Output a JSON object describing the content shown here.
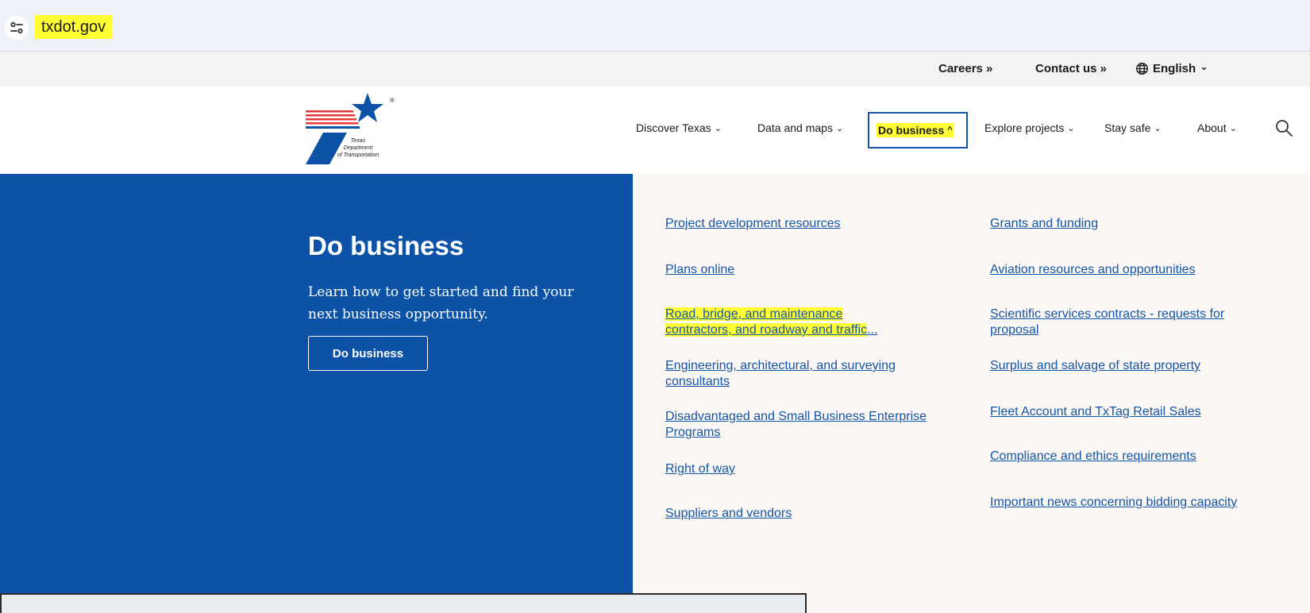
{
  "browser": {
    "url": "txdot.gov"
  },
  "utility_nav": {
    "careers": "Careers »",
    "contact": "Contact us »",
    "language": "English",
    "language_chevron": "⌄"
  },
  "logo": {
    "text_line1": "Texas",
    "text_line2": "Department",
    "text_line3": "of Transportation",
    "registered": "®"
  },
  "main_nav": {
    "chevron_down": "⌄",
    "chevron_up": "^",
    "items": [
      {
        "label": "Discover Texas"
      },
      {
        "label": "Data and maps"
      },
      {
        "label": "Do business"
      },
      {
        "label": "Explore projects"
      },
      {
        "label": "Stay safe"
      },
      {
        "label": "About"
      }
    ]
  },
  "panel": {
    "title": "Do business",
    "description": "Learn how to get started and find your next business opportunity.",
    "button": "Do business"
  },
  "links": {
    "col1": [
      {
        "text": "Project development resources"
      },
      {
        "text": "Plans online"
      },
      {
        "line1": "Road, bridge, and maintenance",
        "line2": "contractors, and roadway and traffic",
        "ellipsis": "..."
      },
      {
        "text": "Engineering, architectural, and surveying consultants"
      },
      {
        "text": "Disadvantaged and Small Business Enterprise Programs"
      },
      {
        "text": "Right of way"
      },
      {
        "text": "Suppliers and vendors"
      }
    ],
    "col2": [
      {
        "text": "Grants and funding"
      },
      {
        "text": "Aviation resources and opportunities"
      },
      {
        "text": "Scientific services contracts - requests for proposal"
      },
      {
        "text": "Surplus and salvage of state property"
      },
      {
        "text": "Fleet Account and TxTag Retail Sales"
      },
      {
        "text": "Compliance and ethics requirements"
      },
      {
        "text": "Important news concerning bidding capacity"
      }
    ]
  },
  "colors": {
    "brand_blue": "#0c53a8",
    "link_blue": "#1555a6",
    "highlight": "#ffff33",
    "logo_red": "#e8353b"
  }
}
